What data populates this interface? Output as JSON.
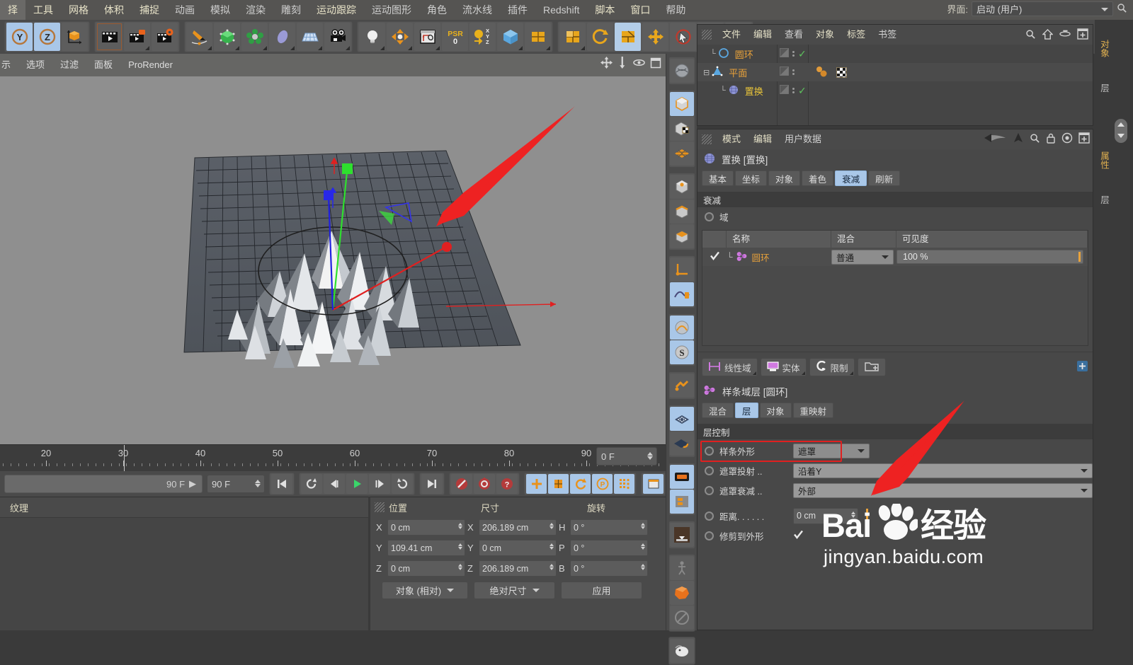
{
  "menubar": {
    "items": [
      {
        "label": "择",
        "dim": false
      },
      {
        "label": "工具",
        "dim": false
      },
      {
        "label": "网格",
        "dim": false
      },
      {
        "label": "体积",
        "dim": false
      },
      {
        "label": "捕捉",
        "dim": false
      },
      {
        "label": "动画",
        "dim": true
      },
      {
        "label": "模拟",
        "dim": true
      },
      {
        "label": "渲染",
        "dim": true
      },
      {
        "label": "雕刻",
        "dim": true
      },
      {
        "label": "运动跟踪",
        "dim": false
      },
      {
        "label": "运动图形",
        "dim": true
      },
      {
        "label": "角色",
        "dim": true
      },
      {
        "label": "流水线",
        "dim": true
      },
      {
        "label": "插件",
        "dim": true
      },
      {
        "label": "Redshift",
        "dim": true
      },
      {
        "label": "脚本",
        "dim": false
      },
      {
        "label": "窗口",
        "dim": false
      },
      {
        "label": "帮助",
        "dim": true
      }
    ],
    "layout_label": "界面:",
    "layout_value": "启动 (用户)"
  },
  "toolbar": {
    "groups": [
      {
        "buttons": [
          {
            "name": "axis-y-toggle",
            "icon": "circle-y",
            "selected": true
          },
          {
            "name": "axis-z-toggle",
            "icon": "circle-z",
            "selected": true
          },
          {
            "name": "object-axis",
            "icon": "cube-axis",
            "selected": false
          }
        ]
      },
      {
        "buttons": [
          {
            "name": "render-view",
            "icon": "clapper",
            "selected": false,
            "highlight": true
          },
          {
            "name": "render-picture-viewer",
            "icon": "clapper-person",
            "selected": false
          },
          {
            "name": "render-settings",
            "icon": "clapper-gear",
            "selected": false
          }
        ]
      },
      {
        "buttons": [
          {
            "name": "pen-spline",
            "icon": "pen",
            "selected": false
          },
          {
            "name": "primitive-cube",
            "icon": "green-cube",
            "selected": false
          },
          {
            "name": "generator",
            "icon": "green-atom",
            "selected": false
          },
          {
            "name": "spline-shape",
            "icon": "blue-blob",
            "selected": false
          },
          {
            "name": "mograph-array",
            "icon": "grid-plane",
            "selected": false
          },
          {
            "name": "camera",
            "icon": "camera",
            "selected": false
          }
        ]
      },
      {
        "buttons": [
          {
            "name": "light",
            "icon": "bulb",
            "selected": false
          },
          {
            "name": "deformer",
            "icon": "arrows-in",
            "selected": false
          },
          {
            "name": "scene-environment",
            "icon": "env-frame",
            "selected": false
          },
          {
            "name": "psr-reset",
            "icon": "psr-0",
            "selected": false
          },
          {
            "name": "coordinate-snap",
            "icon": "xyz-arrow",
            "selected": false
          },
          {
            "name": "deformer-bend",
            "icon": "blue-cube",
            "selected": false
          },
          {
            "name": "unfold-uv",
            "icon": "orange-cube-1",
            "selected": false
          }
        ]
      },
      {
        "buttons": [
          {
            "name": "model-mode",
            "icon": "orange-quad",
            "selected": false
          },
          {
            "name": "rotate-mode",
            "icon": "rotate-circle",
            "selected": false
          },
          {
            "name": "texture-mode",
            "icon": "orange-quad2",
            "selected": true
          },
          {
            "name": "move-tool",
            "icon": "move-cross",
            "selected": false
          },
          {
            "name": "live-select",
            "icon": "cursor-circle",
            "selected": false
          },
          {
            "name": "rect-select",
            "icon": "cursor-circle-2",
            "selected": false
          },
          {
            "name": "snap-toggle",
            "icon": "triangles",
            "selected": false
          }
        ]
      }
    ]
  },
  "viewport": {
    "menu": [
      "示",
      "选项",
      "过滤",
      "面板",
      "ProRender"
    ],
    "nav_icons": [
      "pan-icon",
      "zoom-icon",
      "orbit-icon",
      "maximize-icon"
    ]
  },
  "timeline": {
    "labels": [
      "20",
      "30",
      "40",
      "50",
      "60",
      "70",
      "80",
      "90"
    ],
    "current_frame": "0 F",
    "range_end": "90 F",
    "end_field": "90 F",
    "transport": [
      {
        "name": "goto-start-button",
        "glyph": "|◀"
      },
      {
        "name": "step-back-keyframe-button",
        "glyph": "↺"
      },
      {
        "name": "play-reverse-button",
        "glyph": "◀|"
      },
      {
        "name": "play-button",
        "glyph": "▶"
      },
      {
        "name": "step-forward-button",
        "glyph": "|▶"
      },
      {
        "name": "loop-button",
        "glyph": "↻"
      },
      {
        "name": "goto-end-button",
        "glyph": "▶|"
      }
    ],
    "record_buttons": [
      {
        "name": "record-keyframe-button"
      },
      {
        "name": "autokey-button"
      },
      {
        "name": "keyframe-selection-button"
      }
    ],
    "key_toggles": [
      {
        "name": "position-key-toggle",
        "selected": true
      },
      {
        "name": "scale-key-toggle",
        "selected": true
      },
      {
        "name": "rotation-key-toggle",
        "selected": true
      },
      {
        "name": "param-key-toggle",
        "selected": true
      },
      {
        "name": "pla-key-toggle",
        "selected": true
      }
    ]
  },
  "material_panel": {
    "title": "纹理"
  },
  "coordinates": {
    "headers": [
      "位置",
      "尺寸",
      "旋转"
    ],
    "rows": [
      {
        "axis1": "X",
        "v1": "0 cm",
        "axis2": "X",
        "v2": "206.189 cm",
        "axis3": "H",
        "v3": "0 °"
      },
      {
        "axis1": "Y",
        "v1": "109.41 cm",
        "axis2": "Y",
        "v2": "0 cm",
        "axis3": "P",
        "v3": "0 °"
      },
      {
        "axis1": "Z",
        "v1": "0 cm",
        "axis2": "Z",
        "v2": "206.189 cm",
        "axis3": "B",
        "v3": "0 °"
      }
    ],
    "mode_dropdown": "对象 (相对)",
    "size_dropdown": "绝对尺寸",
    "apply_button": "应用"
  },
  "object_manager": {
    "menu": [
      "文件",
      "编辑",
      "查看",
      "对象",
      "标签",
      "书签"
    ],
    "rows": [
      {
        "name": "圆环",
        "color": "#e8a13a",
        "icon": "circle-spline-icon",
        "indent": 18,
        "check": true
      },
      {
        "name": "平面",
        "color": "#e8a13a",
        "icon": "plane-icon",
        "indent": 8,
        "check": false,
        "tags": true
      },
      {
        "name": "置换",
        "color": "#e8c43a",
        "icon": "displacer-icon",
        "indent": 32,
        "check": true
      }
    ]
  },
  "attribute_manager": {
    "menu": [
      "模式",
      "编辑",
      "用户数据"
    ],
    "object_title": "置换 [置换]",
    "tabs": [
      {
        "label": "基本",
        "active": false
      },
      {
        "label": "坐标",
        "active": false
      },
      {
        "label": "对象",
        "active": false
      },
      {
        "label": "着色",
        "active": false
      },
      {
        "label": "衰减",
        "active": true
      },
      {
        "label": "刷新",
        "active": false
      }
    ],
    "section_falloff": "衰减",
    "field_label": "域",
    "field_table": {
      "headers": [
        "名称",
        "混合",
        "可见度"
      ],
      "rows": [
        {
          "checked": true,
          "name": "圆环",
          "blend": "普通",
          "visibility": "100 %"
        }
      ]
    },
    "field_buttons": [
      {
        "label": "线性域",
        "name": "linear-field-button"
      },
      {
        "label": "实体",
        "name": "solid-field-button"
      },
      {
        "label": "限制",
        "name": "limit-field-button"
      },
      {
        "label": "",
        "name": "add-field-folder-button"
      }
    ],
    "layer_title": "样条域层 [圆环]",
    "layer_tabs": [
      {
        "label": "混合",
        "active": false
      },
      {
        "label": "层",
        "active": true
      },
      {
        "label": "对象",
        "active": false
      },
      {
        "label": "重映射",
        "active": false
      }
    ],
    "section_layer_control": "层控制",
    "properties": [
      {
        "label": "样条外形",
        "value": "遮罩",
        "type": "combo-small",
        "highlighted": true
      },
      {
        "label": "遮罩投射 ..",
        "value": "沿着Y",
        "type": "combo-wide",
        "highlighted": false
      },
      {
        "label": "遮罩衰减 ..",
        "value": "外部",
        "type": "combo-wide",
        "highlighted": false
      },
      {
        "label": "距离. . . . . .",
        "value": "0 cm",
        "type": "number",
        "highlighted": false
      },
      {
        "label": "修剪到外形",
        "value": "",
        "type": "checkbox",
        "checked": true,
        "highlighted": false
      }
    ]
  },
  "right_tabs": [
    {
      "label": "对象",
      "accent": true
    },
    {
      "label": "层",
      "accent": false
    },
    {
      "label": "属性",
      "accent": true
    },
    {
      "label": "层",
      "accent": false
    }
  ],
  "watermark": {
    "brand": "Bai du 经验",
    "sub": "jingyan.baidu.com"
  },
  "annotations": {
    "arrow_color": "#ee2222",
    "arrows": [
      {
        "name": "annotation-arrow-viewport"
      },
      {
        "name": "annotation-arrow-properties"
      }
    ],
    "highlight_box_color": "#e02020"
  },
  "colors": {
    "accent_selected": "#a9c7e8",
    "menu_text": "#e8e3c8",
    "panel_bg": "#4a4a4a",
    "viewport_bg": "#8f8f8f"
  }
}
